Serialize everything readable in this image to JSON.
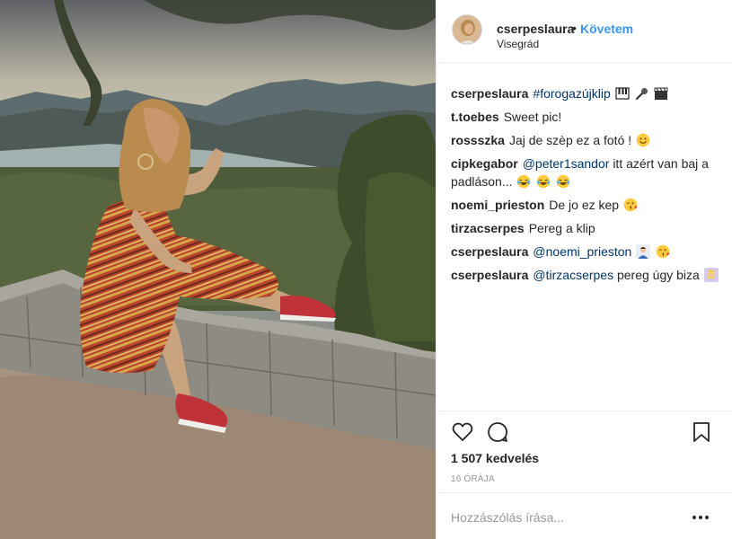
{
  "post": {
    "username": "cserpeslaura",
    "separator": "•",
    "follow_label": "Követem",
    "location": "Visegrád"
  },
  "comments": [
    {
      "user": "cserpeslaura",
      "parts": [
        {
          "type": "hashtag",
          "text": "#forogazújklip"
        },
        {
          "type": "emoji",
          "icon": "piano-emoji"
        },
        {
          "type": "emoji",
          "icon": "microphone-emoji"
        },
        {
          "type": "emoji",
          "icon": "clapperboard-emoji"
        }
      ]
    },
    {
      "user": "t.toebes",
      "parts": [
        {
          "type": "text",
          "text": "Sweet pic!"
        }
      ]
    },
    {
      "user": "rossszka",
      "parts": [
        {
          "type": "text",
          "text": "Jaj de szèp ez a fotó !"
        },
        {
          "type": "emoji",
          "icon": "smiling-face-emoji"
        }
      ]
    },
    {
      "user": "cipkegabor",
      "parts": [
        {
          "type": "mention",
          "text": "@peter1sandor"
        },
        {
          "type": "text",
          "text": " itt azért van baj a padláson..."
        },
        {
          "type": "emoji",
          "icon": "crying-laughing-emoji"
        },
        {
          "type": "emoji",
          "icon": "crying-laughing-emoji"
        },
        {
          "type": "emoji",
          "icon": "crying-laughing-emoji"
        }
      ]
    },
    {
      "user": "noemi_prieston",
      "parts": [
        {
          "type": "text",
          "text": "De jo ez kep"
        },
        {
          "type": "emoji",
          "icon": "kissing-face-emoji"
        }
      ]
    },
    {
      "user": "tirzacserpes",
      "parts": [
        {
          "type": "text",
          "text": "Pereg a klip"
        }
      ]
    },
    {
      "user": "cserpeslaura",
      "parts": [
        {
          "type": "mention",
          "text": "@noemi_prieston"
        },
        {
          "type": "emoji",
          "icon": "person-emoji"
        },
        {
          "type": "emoji",
          "icon": "kissing-face-emoji"
        }
      ]
    },
    {
      "user": "cserpeslaura",
      "parts": [
        {
          "type": "mention",
          "text": "@tirzacserpes"
        },
        {
          "type": "text",
          "text": " pereg úgy biza"
        },
        {
          "type": "emoji",
          "icon": "princess-emoji"
        }
      ]
    }
  ],
  "stats": {
    "likes": "1 507 kedvelés",
    "time": "16 ÓRÁJA"
  },
  "comment_box": {
    "placeholder": "Hozzászólás írása..."
  },
  "icons": {
    "like": "heart-icon",
    "comment": "comment-bubble-icon",
    "save": "bookmark-icon",
    "more": "more-dots-icon"
  },
  "colors": {
    "link": "#003569",
    "follow": "#3897f0",
    "text": "#262626",
    "muted": "#999999",
    "border": "#efefef"
  }
}
